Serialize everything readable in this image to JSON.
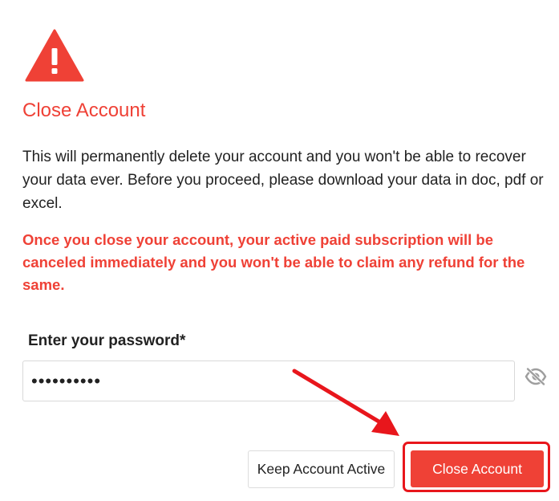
{
  "dialog": {
    "title": "Close Account",
    "description": "This will permanently delete your account and you won't be able to recover your data ever. Before you proceed, please download your data in doc, pdf or excel.",
    "warning": "Once you close your account, your active paid subscription will be canceled immediately and you won't be able to claim any refund for the same.",
    "password_label": "Enter your password*",
    "password_value": "••••••••••",
    "keep_button_label": "Keep Account Active",
    "close_button_label": "Close Account"
  },
  "icons": {
    "warning": "warning-triangle-icon",
    "visibility_toggle": "eye-slash-icon",
    "annotation_arrow": "red-arrow-annotation"
  },
  "colors": {
    "accent_red": "#ef4136",
    "highlight_red": "#e8161c",
    "text": "#222222",
    "icon_gray": "#9e9e9e"
  }
}
